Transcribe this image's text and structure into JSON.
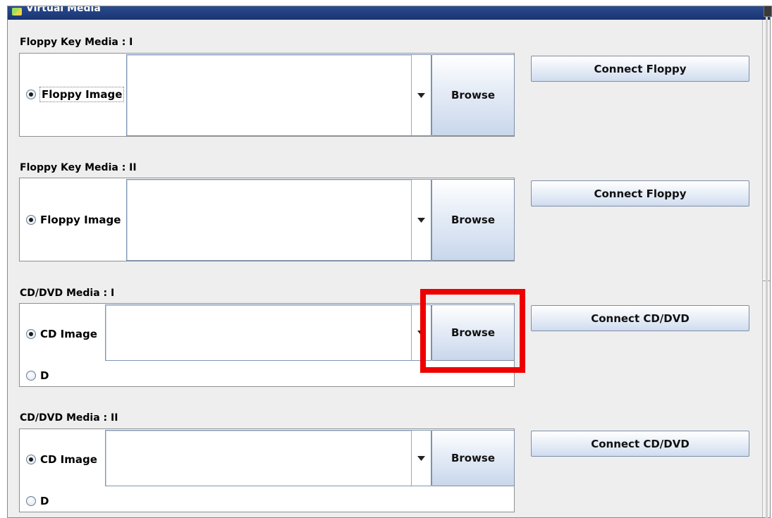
{
  "window": {
    "title": "Virtual Media"
  },
  "sections": [
    {
      "label": "Floppy Key Media : I",
      "radio_label": "Floppy Image",
      "browse_label": "Browse",
      "connect_label": "Connect Floppy"
    },
    {
      "label": "Floppy Key Media : II",
      "radio_label": "Floppy Image",
      "browse_label": "Browse",
      "connect_label": "Connect Floppy"
    },
    {
      "label": "CD/DVD Media : I",
      "radio_label": "CD Image",
      "drive_label": "D",
      "browse_label": "Browse",
      "connect_label": "Connect CD/DVD"
    },
    {
      "label": "CD/DVD Media : II",
      "radio_label": "CD Image",
      "drive_label": "D",
      "browse_label": "Browse",
      "connect_label": "Connect CD/DVD"
    }
  ],
  "highlight": {
    "color": "#ee0000"
  }
}
